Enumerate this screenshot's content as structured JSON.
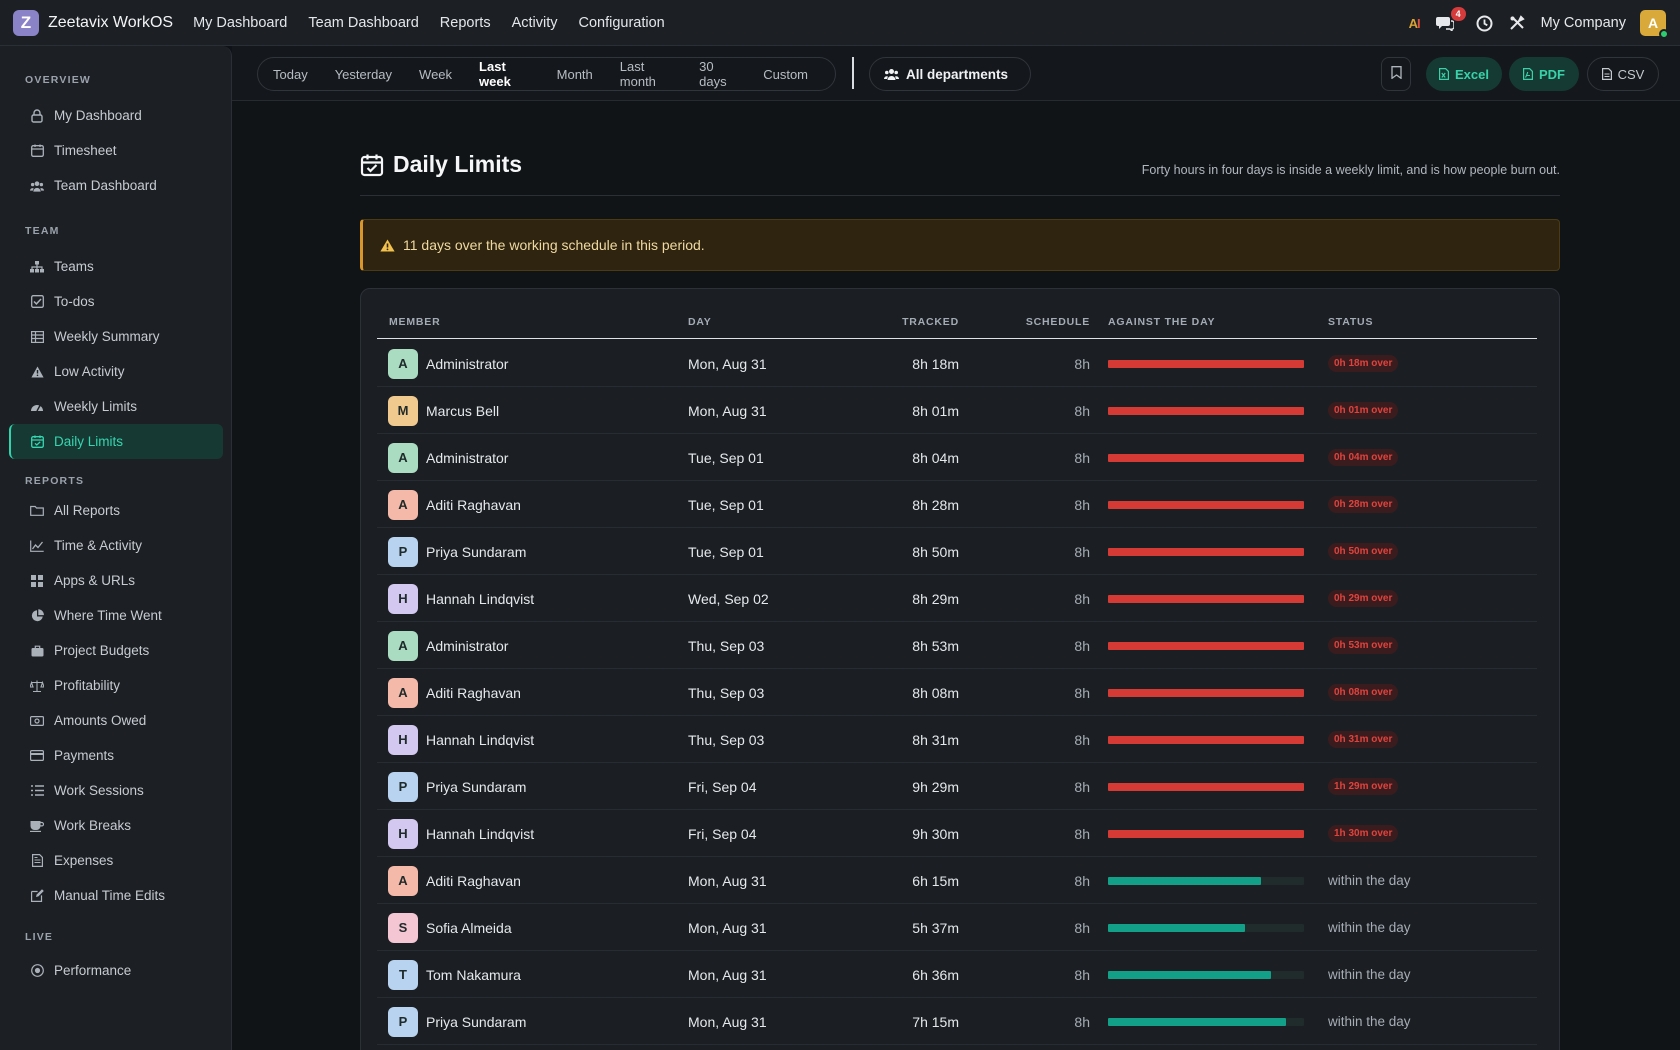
{
  "app": {
    "logo_letter": "Z",
    "brand": "Zeetavix WorkOS",
    "nav": [
      "My Dashboard",
      "Team Dashboard",
      "Reports",
      "Activity",
      "Configuration"
    ],
    "ai_label_a": "A",
    "ai_label_b": "I",
    "messages_badge": "4",
    "company": "My Company",
    "avatar_letter": "A"
  },
  "sidebar": {
    "sections": [
      {
        "title": "OVERVIEW",
        "items": [
          {
            "label": "My Dashboard",
            "icon": "lock-icon"
          },
          {
            "label": "Timesheet",
            "icon": "calendar-icon"
          },
          {
            "label": "Team Dashboard",
            "icon": "users-icon"
          }
        ]
      },
      {
        "title": "TEAM",
        "items": [
          {
            "label": "Teams",
            "icon": "sitemap-icon"
          },
          {
            "label": "To-dos",
            "icon": "checkbox-icon"
          },
          {
            "label": "Weekly Summary",
            "icon": "table-icon"
          },
          {
            "label": "Low Activity",
            "icon": "warning-icon"
          },
          {
            "label": "Weekly Limits",
            "icon": "gauge-icon"
          },
          {
            "label": "Daily Limits",
            "icon": "calendar-check-icon",
            "active": true
          }
        ]
      },
      {
        "title": "REPORTS",
        "items": [
          {
            "label": "All Reports",
            "icon": "folder-icon"
          },
          {
            "label": "Time & Activity",
            "icon": "line-chart-icon"
          },
          {
            "label": "Apps & URLs",
            "icon": "grid-icon"
          },
          {
            "label": "Where Time Went",
            "icon": "pie-chart-icon"
          },
          {
            "label": "Project Budgets",
            "icon": "briefcase-icon"
          },
          {
            "label": "Profitability",
            "icon": "scale-icon"
          },
          {
            "label": "Amounts Owed",
            "icon": "money-icon"
          },
          {
            "label": "Payments",
            "icon": "credit-card-icon"
          },
          {
            "label": "Work Sessions",
            "icon": "list-icon"
          },
          {
            "label": "Work Breaks",
            "icon": "coffee-icon"
          },
          {
            "label": "Expenses",
            "icon": "receipt-icon"
          },
          {
            "label": "Manual Time Edits",
            "icon": "edit-icon"
          }
        ]
      },
      {
        "title": "LIVE",
        "items": [
          {
            "label": "Performance",
            "icon": "target-icon"
          }
        ]
      }
    ]
  },
  "filters": {
    "ranges": [
      "Today",
      "Yesterday",
      "Week",
      "Last week",
      "Month",
      "Last month",
      "30 days",
      "Custom"
    ],
    "selected_range": "Last week",
    "department": "All departments",
    "export_excel": "Excel",
    "export_pdf": "PDF",
    "export_csv": "CSV"
  },
  "page": {
    "title": "Daily Limits",
    "subtitle": "Forty hours in four days is inside a weekly limit, and is how people burn out.",
    "alert": "11 days over the working schedule in this period."
  },
  "table": {
    "columns": [
      "MEMBER",
      "DAY",
      "TRACKED",
      "SCHEDULE",
      "AGAINST THE DAY",
      "STATUS"
    ],
    "rows": [
      {
        "initial": "A",
        "member": "Administrator",
        "day": "Mon, Aug 31",
        "tracked": "8h 18m",
        "schedule": "8h",
        "ratio": 1.0,
        "over": true,
        "status": "0h 18m over"
      },
      {
        "initial": "M",
        "member": "Marcus Bell",
        "day": "Mon, Aug 31",
        "tracked": "8h 01m",
        "schedule": "8h",
        "ratio": 1.0,
        "over": true,
        "status": "0h 01m over"
      },
      {
        "initial": "A",
        "member": "Administrator",
        "day": "Tue, Sep 01",
        "tracked": "8h 04m",
        "schedule": "8h",
        "ratio": 1.0,
        "over": true,
        "status": "0h 04m over"
      },
      {
        "initial": "A",
        "member": "Aditi Raghavan",
        "day": "Tue, Sep 01",
        "tracked": "8h 28m",
        "schedule": "8h",
        "ratio": 1.0,
        "over": true,
        "status": "0h 28m over"
      },
      {
        "initial": "P",
        "member": "Priya Sundaram",
        "day": "Tue, Sep 01",
        "tracked": "8h 50m",
        "schedule": "8h",
        "ratio": 1.0,
        "over": true,
        "status": "0h 50m over"
      },
      {
        "initial": "H",
        "member": "Hannah Lindqvist",
        "day": "Wed, Sep 02",
        "tracked": "8h 29m",
        "schedule": "8h",
        "ratio": 1.0,
        "over": true,
        "status": "0h 29m over"
      },
      {
        "initial": "A",
        "member": "Administrator",
        "day": "Thu, Sep 03",
        "tracked": "8h 53m",
        "schedule": "8h",
        "ratio": 1.0,
        "over": true,
        "status": "0h 53m over"
      },
      {
        "initial": "A",
        "member": "Aditi Raghavan",
        "day": "Thu, Sep 03",
        "tracked": "8h 08m",
        "schedule": "8h",
        "ratio": 1.0,
        "over": true,
        "status": "0h 08m over"
      },
      {
        "initial": "H",
        "member": "Hannah Lindqvist",
        "day": "Thu, Sep 03",
        "tracked": "8h 31m",
        "schedule": "8h",
        "ratio": 1.0,
        "over": true,
        "status": "0h 31m over"
      },
      {
        "initial": "P",
        "member": "Priya Sundaram",
        "day": "Fri, Sep 04",
        "tracked": "9h 29m",
        "schedule": "8h",
        "ratio": 1.0,
        "over": true,
        "status": "1h 29m over"
      },
      {
        "initial": "H",
        "member": "Hannah Lindqvist",
        "day": "Fri, Sep 04",
        "tracked": "9h 30m",
        "schedule": "8h",
        "ratio": 1.0,
        "over": true,
        "status": "1h 30m over"
      },
      {
        "initial": "A",
        "member": "Aditi Raghavan",
        "day": "Mon, Aug 31",
        "tracked": "6h 15m",
        "schedule": "8h",
        "ratio": 0.78,
        "over": false,
        "status": "within the day"
      },
      {
        "initial": "S",
        "member": "Sofia Almeida",
        "day": "Mon, Aug 31",
        "tracked": "5h 37m",
        "schedule": "8h",
        "ratio": 0.7,
        "over": false,
        "status": "within the day"
      },
      {
        "initial": "T",
        "member": "Tom Nakamura",
        "day": "Mon, Aug 31",
        "tracked": "6h 36m",
        "schedule": "8h",
        "ratio": 0.83,
        "over": false,
        "status": "within the day"
      },
      {
        "initial": "P",
        "member": "Priya Sundaram",
        "day": "Mon, Aug 31",
        "tracked": "7h 15m",
        "schedule": "8h",
        "ratio": 0.91,
        "over": false,
        "status": "within the day"
      }
    ]
  },
  "colors": {
    "accent": "#35d6b0",
    "over_bar": "#d63a35",
    "within_bar": "#13a088",
    "avatar_A": "#a9dcc0",
    "avatar_M": "#f0c98e",
    "avatar_P": "#b7d3f0",
    "avatar_H": "#d3c8f0",
    "avatar_A2": "#f4b9a8",
    "avatar_S": "#f4c5d2",
    "avatar_T": "#b7d3f0"
  }
}
